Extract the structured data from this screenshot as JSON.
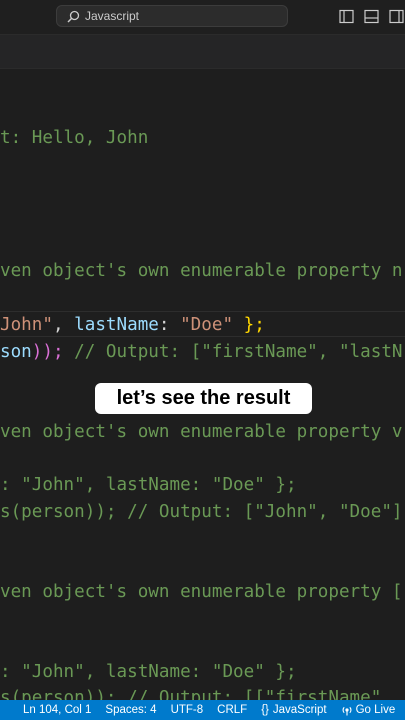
{
  "titlebar": {
    "search_text": "Javascript",
    "icons": [
      "search-icon",
      "toggle-primary-sidebar-icon",
      "toggle-panel-icon",
      "toggle-secondary-sidebar-icon"
    ]
  },
  "editor": {
    "lines": {
      "l1": "t: Hello, John",
      "l2": "ven object's own enumerable property n",
      "l3_a": "John\"",
      "l3_b": ", ",
      "l3_c": "lastName",
      "l3_d": ": ",
      "l3_e": "\"Doe\"",
      "l3_f": " ",
      "l3_g": "};",
      "l4_a": "son",
      "l4_b": "));",
      "l4_c": " // Output: [\"firstName\", \"lastN",
      "l5": "ven object's own enumerable property v",
      "l6": ": \"John\", lastName: \"Doe\" };",
      "l7": "s(person)); // Output: [\"John\", \"Doe\"]",
      "l8": "ven object's own enumerable property [",
      "l9": ": \"John\", lastName: \"Doe\" };",
      "l10": "s(person)); // Output: [[\"firstName\","
    }
  },
  "caption": "let’s see the result",
  "statusbar": {
    "position": "Ln 104, Col 1",
    "spaces": "Spaces: 4",
    "encoding": "UTF-8",
    "eol": "CRLF",
    "language_brackets": "{}",
    "language": "JavaScript",
    "go_live": "Go Live",
    "color": "#007acc"
  },
  "colors": {
    "comment": "#6a9955",
    "string": "#ce9178",
    "property": "#9cdcfe",
    "background": "#1e1e1e"
  }
}
